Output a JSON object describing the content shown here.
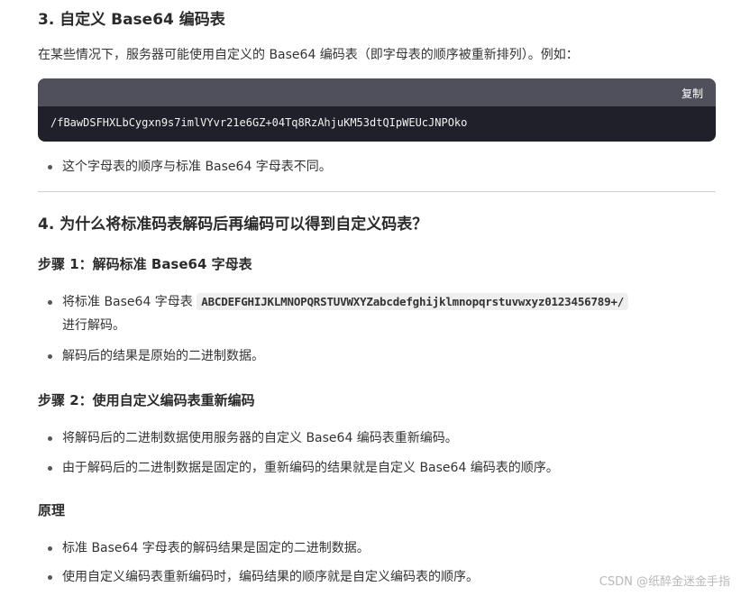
{
  "section3": {
    "heading": "3. 自定义 Base64 编码表",
    "intro": "在某些情况下，服务器可能使用自定义的 Base64 编码表（即字母表的顺序被重新排列）。例如：",
    "code": {
      "copy_label": "复制",
      "content": "/fBawDSFHXLbCygxn9s7imlVYvr21e6GZ+04Tq8RzAhjuKM53dtQIpWEUcJNPOko"
    },
    "bullets": [
      "这个字母表的顺序与标准 Base64 字母表不同。"
    ]
  },
  "section4": {
    "heading": "4. 为什么将标准码表解码后再编码可以得到自定义码表？",
    "step1": {
      "heading": "步骤 1：解码标准 Base64 字母表",
      "bullet1_prefix": "将标准 Base64 字母表",
      "bullet1_code": "ABCDEFGHIJKLMNOPQRSTUVWXYZabcdefghijklmnopqrstuvwxyz0123456789+/",
      "bullet1_suffix": "进行解码。",
      "bullet2": "解码后的结果是原始的二进制数据。"
    },
    "step2": {
      "heading": "步骤 2：使用自定义编码表重新编码",
      "bullets": [
        "将解码后的二进制数据使用服务器的自定义 Base64 编码表重新编码。",
        "由于解码后的二进制数据是固定的，重新编码的结果就是自定义 Base64 编码表的顺序。"
      ]
    },
    "principle": {
      "heading": "原理",
      "bullets": [
        "标准 Base64 字母表的解码结果是固定的二进制数据。",
        "使用自定义编码表重新编码时，编码结果的顺序就是自定义编码表的顺序。"
      ]
    }
  },
  "watermark": "CSDN @纸醉金迷金手指"
}
